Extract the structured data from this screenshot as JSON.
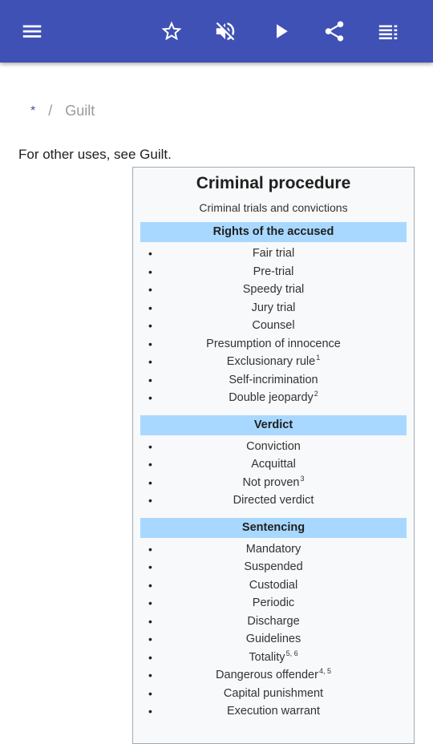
{
  "appbar": {
    "icons": [
      "menu-icon",
      "star-icon",
      "volume-off-icon",
      "play-icon",
      "share-icon",
      "list-icon"
    ],
    "color": "#3f51b5"
  },
  "breadcrumb": {
    "home": "*",
    "separator": "/",
    "current": "Guilt"
  },
  "hatnote": "For other uses, see Guilt.",
  "infobox": {
    "title": "Criminal procedure",
    "subtitle": "Criminal trials and convictions",
    "sections": [
      {
        "heading": "Rights of the accused",
        "items": [
          {
            "text": "Fair trial",
            "sup": ""
          },
          {
            "text": "Pre-trial",
            "sup": ""
          },
          {
            "text": "Speedy trial",
            "sup": ""
          },
          {
            "text": "Jury trial",
            "sup": ""
          },
          {
            "text": "Counsel",
            "sup": ""
          },
          {
            "text": "Presumption of innocence",
            "sup": ""
          },
          {
            "text": "Exclusionary rule",
            "sup": "1"
          },
          {
            "text": "Self-incrimination",
            "sup": ""
          },
          {
            "text": "Double jeopardy",
            "sup": "2"
          }
        ]
      },
      {
        "heading": "Verdict",
        "items": [
          {
            "text": "Conviction",
            "sup": ""
          },
          {
            "text": "Acquittal",
            "sup": ""
          },
          {
            "text": "Not proven",
            "sup": "3"
          },
          {
            "text": "Directed verdict",
            "sup": ""
          }
        ]
      },
      {
        "heading": "Sentencing",
        "items": [
          {
            "text": "Mandatory",
            "sup": ""
          },
          {
            "text": "Suspended",
            "sup": ""
          },
          {
            "text": "Custodial",
            "sup": ""
          },
          {
            "text": "Periodic",
            "sup": ""
          },
          {
            "text": "Discharge",
            "sup": ""
          },
          {
            "text": "Guidelines",
            "sup": ""
          },
          {
            "text": "Totality",
            "sup": "5, 6"
          },
          {
            "text": "Dangerous offender",
            "sup": "4, 5"
          },
          {
            "text": "Capital punishment",
            "sup": ""
          },
          {
            "text": "Execution warrant",
            "sup": ""
          }
        ]
      }
    ]
  }
}
